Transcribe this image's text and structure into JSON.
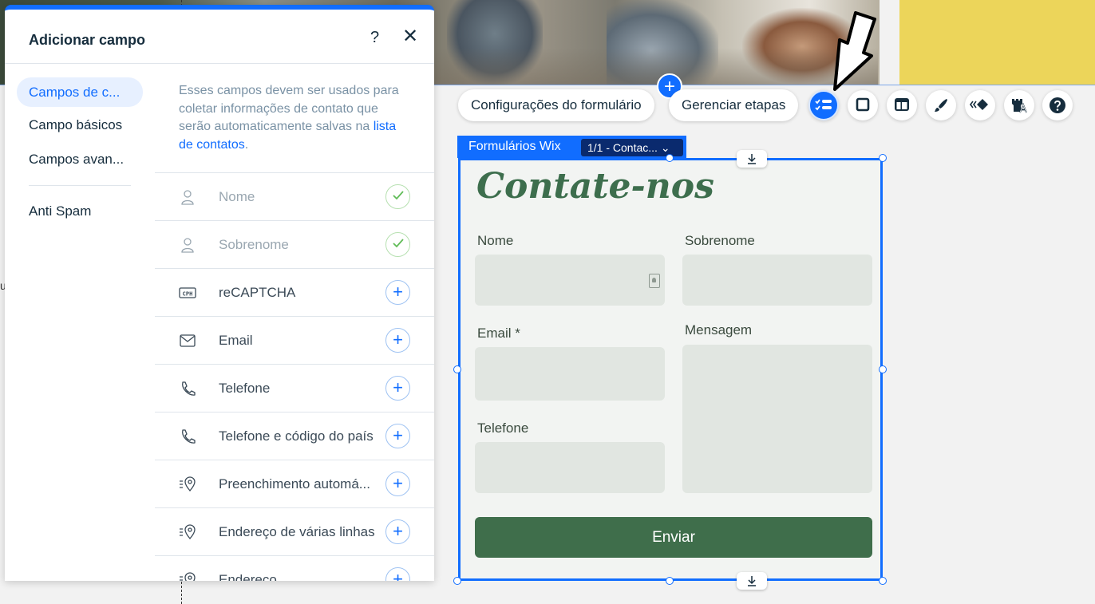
{
  "panel": {
    "title": "Adicionar campo",
    "help": "?",
    "close": "✕",
    "sidebar": [
      {
        "label": "Campos de c..."
      },
      {
        "label": "Campo básicos"
      },
      {
        "label": "Campos avan..."
      },
      {
        "label": "Anti Spam"
      }
    ],
    "description": "Esses campos devem ser usados para coletar informações de contato que serão automaticamente salvas na ",
    "description_link": "lista de contatos",
    "description_end": ".",
    "fields": [
      {
        "label": "Nome",
        "icon": "person-icon",
        "state": "added"
      },
      {
        "label": "Sobrenome",
        "icon": "person-icon",
        "state": "added"
      },
      {
        "label": "reCAPTCHA",
        "icon": "captcha-icon",
        "state": "add"
      },
      {
        "label": "Email",
        "icon": "envelope-icon",
        "state": "add"
      },
      {
        "label": "Telefone",
        "icon": "phone-icon",
        "state": "add"
      },
      {
        "label": "Telefone e código do país",
        "icon": "phone-icon",
        "state": "add"
      },
      {
        "label": "Preenchimento automá...",
        "icon": "location-icon",
        "state": "add"
      },
      {
        "label": "Endereço de várias linhas",
        "icon": "location-icon",
        "state": "add"
      },
      {
        "label": "Endereço",
        "icon": "location-icon",
        "state": "add"
      }
    ],
    "captcha_icon_text": "CPH",
    "add_glyph": "+"
  },
  "toolbar": {
    "plus": "+",
    "form_settings": "Configurações do formulário",
    "manage_steps": "Gerenciar etapas"
  },
  "form": {
    "widget_label": "Formulários Wix",
    "step_select": "1/1 - Contac... ⌄",
    "title": "Contate-nos",
    "first_name_label": "Nome",
    "last_name_label": "Sobrenome",
    "email_label": "Email *",
    "message_label": "Mensagem",
    "phone_label": "Telefone",
    "submit_label": "Enviar"
  },
  "canvas": {
    "edge_text": "u"
  },
  "colors": {
    "accent": "#116dff",
    "form_green": "#3f6e4b",
    "yellow_strip": "#ecd55a"
  }
}
